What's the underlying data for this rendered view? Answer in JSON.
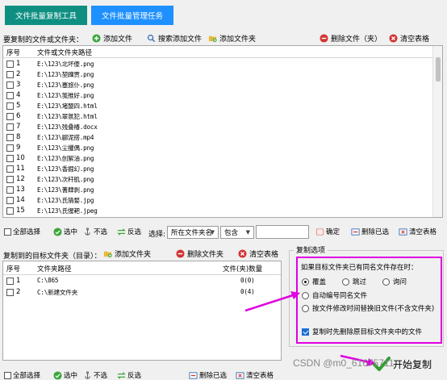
{
  "tabs": [
    "文件批量复制工具",
    "文件批量管理任务"
  ],
  "source": {
    "label": "要复制的文件或文件夹：",
    "toolbar": {
      "add_file": "添加文件",
      "search_add_file": "搜索添加文件",
      "add_folder": "添加文件夹",
      "delete": "删除文件（夹）",
      "clear": "清空表格"
    },
    "columns": [
      "序号",
      "文件或文件夹路径"
    ],
    "rows": [
      {
        "num": "1",
        "path": "E:\\123\\北坏傻.png"
      },
      {
        "num": "2",
        "path": "E:\\123\\堃蹿贾.png"
      },
      {
        "num": "3",
        "path": "E:\\123\\蹇旅仆.png"
      },
      {
        "num": "4",
        "path": "E:\\123\\笺推好.png"
      },
      {
        "num": "5",
        "path": "E:\\123\\堵盟四.html"
      },
      {
        "num": "6",
        "path": "E:\\123\\翠氛犯.html"
      },
      {
        "num": "7",
        "path": "E:\\123\\残叠椿.docx"
      },
      {
        "num": "8",
        "path": "E:\\123\\郦泥搭.mp4"
      },
      {
        "num": "9",
        "path": "E:\\123\\尘攫偶.png"
      },
      {
        "num": "10",
        "path": "E:\\123\\创絮油.png"
      },
      {
        "num": "11",
        "path": "E:\\123\\香掘幻.png"
      },
      {
        "num": "12",
        "path": "E:\\123\\次秆肌.png"
      },
      {
        "num": "13",
        "path": "E:\\123\\蓍肆剥.png"
      },
      {
        "num": "14",
        "path": "E:\\123\\氏猜婺.jpg"
      },
      {
        "num": "15",
        "path": "E:\\123\\氏惺耙.jpeg"
      }
    ],
    "bottom": {
      "select_all": "全部选择",
      "select": "选中",
      "unselect": "不选",
      "invert": "反选",
      "choose_label": "选择:",
      "filter_field": "所在文件夹名",
      "filter_op": "包含",
      "confirm": "确定",
      "delete_selected": "删除已选",
      "clear": "清空表格"
    }
  },
  "target": {
    "label": "复制到的目标文件夹（目录）：",
    "toolbar": {
      "add_folder": "添加文件夹",
      "delete_folder": "删除文件夹",
      "clear": "清空表格"
    },
    "columns": [
      "序号",
      "文件夹路径",
      "文件(夹)数量"
    ],
    "rows": [
      {
        "num": "1",
        "path": "C:\\865",
        "count": "0(0)"
      },
      {
        "num": "2",
        "path": "C:\\新建文件夹",
        "count": "0(4)"
      }
    ],
    "bottom": {
      "select_all": "全部选择",
      "select": "选中",
      "unselect": "不选",
      "invert": "反选",
      "delete_selected": "删除已选",
      "clear": "清空表格"
    }
  },
  "options": {
    "title": "复制选项",
    "conflict_label": "如果目标文件夹已有同名文件存在时：",
    "overwrite": "覆盖",
    "skip": "跳过",
    "ask": "询问",
    "auto_rename": "自动编号同名文件",
    "replace_by_time": "按文件修改时间替换旧文件(不含文件夹)",
    "delete_first": "复制时先删除原目标文件夹中的文件"
  },
  "start_button": "开始复制",
  "watermark": "CSDN @m0_61675711",
  "colors": {
    "tab_active": "#0e8f82",
    "tab_inactive": "#1e90ff",
    "highlight": "#e000e0",
    "add_icon": "#3aa63a",
    "delete_icon": "#d33333"
  }
}
